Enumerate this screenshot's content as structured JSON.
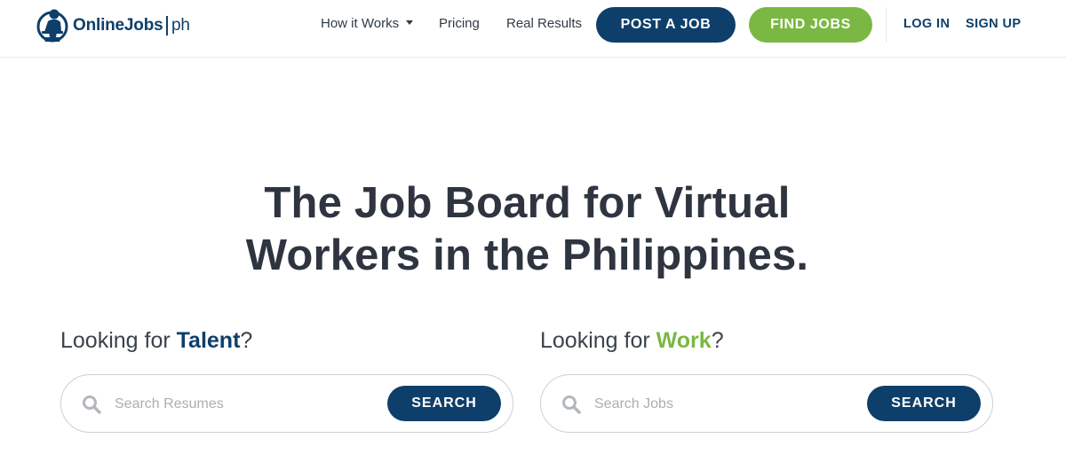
{
  "brand": {
    "name": "OnlineJobs",
    "suffix": "ph",
    "logo_icon": "worker-at-laptop-icon",
    "color_primary": "#0e3f6a",
    "color_accent": "#7ab843"
  },
  "nav": {
    "how_it_works": "How it Works",
    "pricing": "Pricing",
    "real_results": "Real Results",
    "post_job": "POST A JOB",
    "find_jobs": "FIND JOBS",
    "log_in": "LOG IN",
    "sign_up": "SIGN UP"
  },
  "hero": {
    "title_line1": "The Job Board for Virtual",
    "title_line2": "Workers in the Philippines."
  },
  "talent_search": {
    "prefix": "Looking for ",
    "keyword": "Talent",
    "suffix": "?",
    "placeholder": "Search Resumes",
    "button": "SEARCH"
  },
  "work_search": {
    "prefix": "Looking for ",
    "keyword": "Work",
    "suffix": "?",
    "placeholder": "Search Jobs",
    "button": "SEARCH"
  }
}
